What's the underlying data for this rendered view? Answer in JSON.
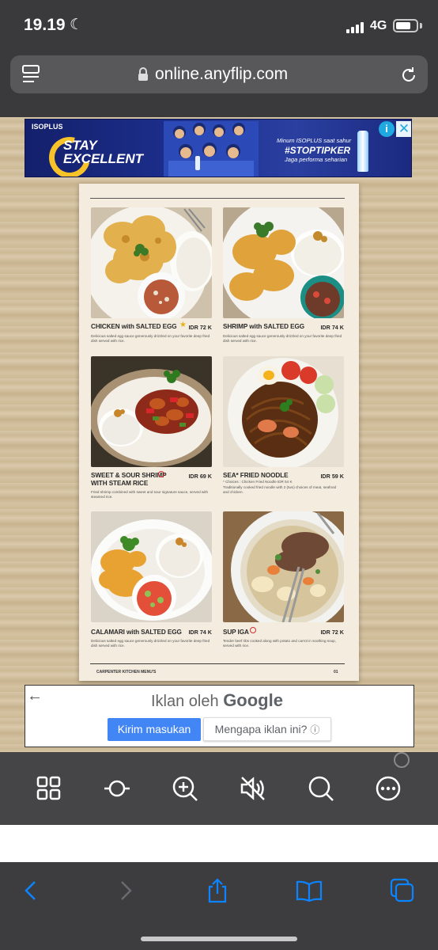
{
  "status_bar": {
    "time": "19.19",
    "network": "4G",
    "battery_level": 0.75
  },
  "browser": {
    "url": "online.anyflip.com"
  },
  "top_ad": {
    "brand": "ISOPLUS",
    "headline": "STAY EXCELLENT",
    "line1": "Minum ISOPLUS saat sahur",
    "hashtag": "#STOPTIPKER",
    "line3": "Jaga performa seharian"
  },
  "menu": {
    "items": [
      {
        "name": "CHICKEN with SALTED EGG",
        "price": "IDR 72 K",
        "desc": "Delicious salted egg sauce generously drizzled on your favorite deep fried dish served with rice.",
        "note": "",
        "has_star": true,
        "has_chili": false,
        "photo": "chicken"
      },
      {
        "name": "SHRIMP with SALTED EGG",
        "price": "IDR 74 K",
        "desc": "Delicious salted egg sauce generously drizzled on your favorite deep fried dish served with rice.",
        "note": "",
        "has_star": false,
        "has_chili": false,
        "photo": "shrimp"
      },
      {
        "name": "SWEET & SOUR SHRIMP WITH STEAM RICE",
        "price": "IDR 69 K",
        "desc": "Fried shrimp combined with sweet and sour signature sauce, served with steamed rice.",
        "note": "",
        "has_star": false,
        "has_chili": true,
        "photo": "sweetsour"
      },
      {
        "name": "SEA* FRIED NOODLE",
        "price": "IDR 59 K",
        "desc": "Traditionally cooked fried noodle with 2 (two) choices of meat, seafood and chicken.",
        "note": "* Choices : Chicken Fried Noodle IDR 54 K",
        "has_star": false,
        "has_chili": false,
        "photo": "noodle"
      },
      {
        "name": "CALAMARI with SALTED EGG",
        "price": "IDR 74 K",
        "desc": "Delicious salted egg sauce generously drizzled on your favorite deep fried dish served with rice.",
        "note": "",
        "has_star": false,
        "has_chili": false,
        "photo": "calamari"
      },
      {
        "name": "SUP IGA",
        "price": "IDR 72 K",
        "desc": "Tender beef ribs cooked along with potato and carrot in soothing soup, served with rice.",
        "note": "",
        "has_star": false,
        "has_chili": true,
        "photo": "soup"
      }
    ],
    "footer_left": "CARPENTER KITCHEN MENU'S",
    "footer_page": "01"
  },
  "bottom_ad": {
    "ads_by": "Iklan oleh",
    "google": "Google",
    "send_feedback": "Kirim masukan",
    "why_ad": "Mengapa iklan ini?",
    "info_glyph": "ⓘ"
  },
  "viewer_toolbar": [
    "grid-icon",
    "autoflip-icon",
    "zoom-in-icon",
    "mute-icon",
    "search-icon",
    "more-icon"
  ],
  "safari_toolbar": [
    "back-icon",
    "forward-icon",
    "share-icon",
    "bookmarks-icon",
    "tabs-icon"
  ],
  "colors": {
    "accent": "#0a84ff",
    "ad_button": "#4285f4",
    "dark_ui": "#3a3a3c"
  }
}
